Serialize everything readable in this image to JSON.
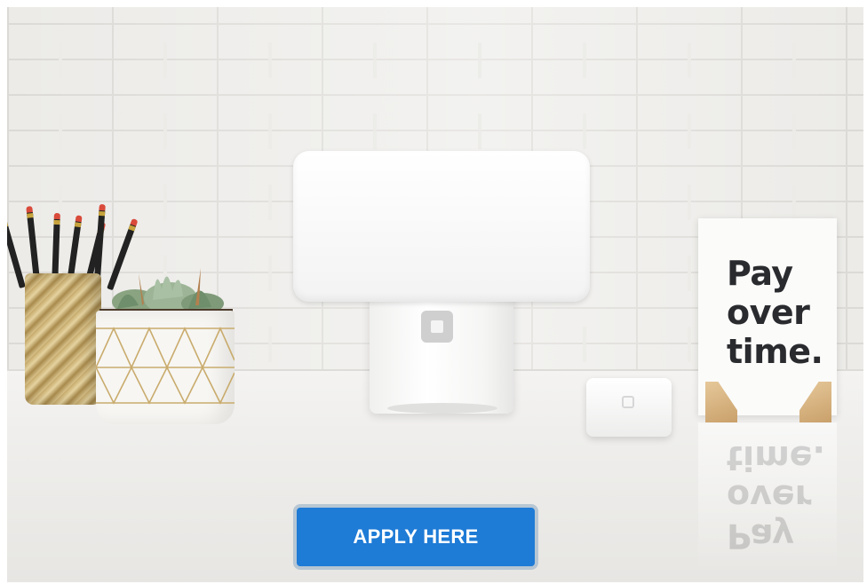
{
  "sign": {
    "lines": [
      "Pay",
      "over",
      "time."
    ]
  },
  "cta": {
    "label": "APPLY HERE"
  },
  "colors": {
    "cta_background": "#1e7bd6",
    "cta_border": "#b7c6d3",
    "sign_text": "#2a2b2e"
  },
  "icons": {
    "terminal_logo": "square-logo-icon",
    "reader_logo": "square-logo-icon"
  }
}
